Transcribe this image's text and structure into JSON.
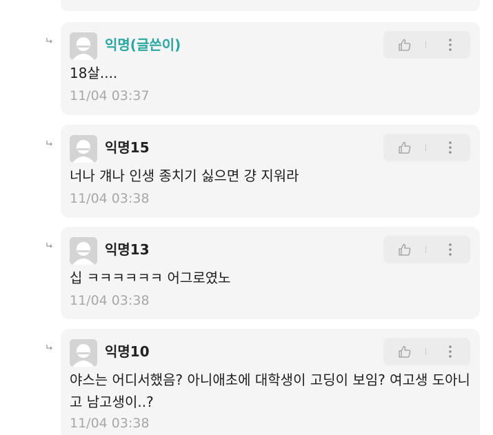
{
  "comments": [
    {
      "author": "익명(글쓴이)",
      "is_op": true,
      "text": "18살....",
      "timestamp": "11/04 03:37",
      "author_color": "#2aa6a0"
    },
    {
      "author": "익명15",
      "is_op": false,
      "text": "너나 걔나 인생 종치기 싫으면 걍 지워라",
      "timestamp": "11/04 03:38"
    },
    {
      "author": "익명13",
      "is_op": false,
      "text": "십 ㅋㅋㅋㅋㅋㅋ 어그로였노",
      "timestamp": "11/04 03:38"
    },
    {
      "author": "익명10",
      "is_op": false,
      "text": "야스는 어디서했음? 아니애초에 대학생이 고딩이 보임? 여고생 도아니고 남고생이..?",
      "timestamp": "11/04 03:38"
    }
  ],
  "icons": {
    "reply": "reply-arrow-icon",
    "avatar": "anonymous-avatar-icon",
    "like": "thumbs-up-icon",
    "more": "more-vertical-icon"
  }
}
